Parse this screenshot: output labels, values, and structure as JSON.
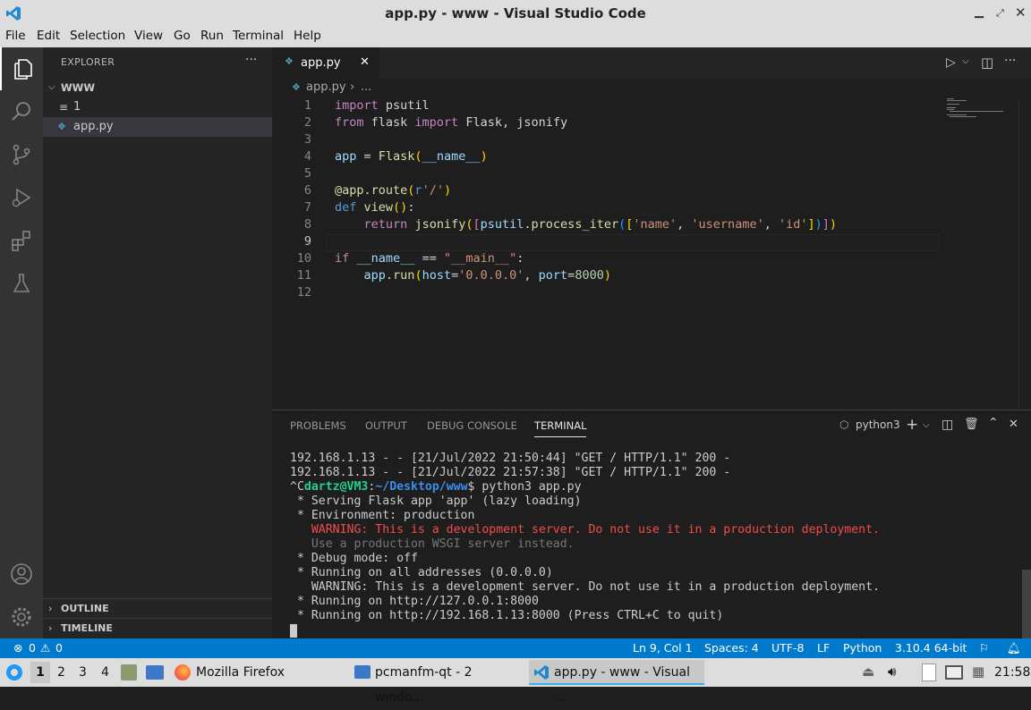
{
  "window": {
    "title": "app.py - www - Visual Studio Code"
  },
  "menu": [
    "File",
    "Edit",
    "Selection",
    "View",
    "Go",
    "Run",
    "Terminal",
    "Help"
  ],
  "sidebar": {
    "title": "EXPLORER",
    "more": "···",
    "folder": "WWW",
    "items": [
      {
        "label": "1"
      },
      {
        "label": "app.py"
      }
    ],
    "sections": [
      "OUTLINE",
      "TIMELINE"
    ]
  },
  "tab": {
    "label": "app.py"
  },
  "breadcrumb": {
    "file": "app.py",
    "sep": "›",
    "more": "..."
  },
  "editor": {
    "line_numbers": [
      "1",
      "2",
      "3",
      "4",
      "5",
      "6",
      "7",
      "8",
      "9",
      "10",
      "11",
      "12"
    ],
    "current_line": 9
  },
  "panel": {
    "tabs": [
      "PROBLEMS",
      "OUTPUT",
      "DEBUG CONSOLE",
      "TERMINAL"
    ],
    "active_tab": "TERMINAL",
    "terminal_name": "python3",
    "lines": [
      "192.168.1.13 - - [21/Jul/2022 21:50:44] \"GET / HTTP/1.1\" 200 -",
      "192.168.1.13 - - [21/Jul/2022 21:57:38] \"GET / HTTP/1.1\" 200 -",
      "",
      " * Serving Flask app 'app' (lazy loading)",
      " * Environment: production",
      "   WARNING: This is a development server. Do not use it in a production deployment.",
      "   Use a production WSGI server instead.",
      " * Debug mode: off",
      " * Running on all addresses (0.0.0.0)",
      "   WARNING: This is a development server. Do not use it in a production deployment.",
      " * Running on http://127.0.0.1:8000",
      " * Running on http://192.168.1.13:8000 (Press CTRL+C to quit)"
    ],
    "prompt": {
      "ctrl": "^C",
      "user": "dartz@VM3",
      "colon": ":",
      "path": "~/Desktop/www",
      "cmd": "$ python3 app.py"
    }
  },
  "status": {
    "errors": "0",
    "warnings": "0",
    "position": "Ln 9, Col 1",
    "spaces": "Spaces: 4",
    "encoding": "UTF-8",
    "eol": "LF",
    "language": "Python",
    "interpreter": "3.10.4 64-bit"
  },
  "taskbar": {
    "workspaces": [
      "1",
      "2",
      "3",
      "4"
    ],
    "windows": [
      "Mozilla Firefox",
      "pcmanfm-qt - 2 windo...",
      "app.py - www - Visual ..."
    ],
    "clock": "21:58"
  },
  "colors": {
    "accent": "#007acc",
    "warning_text": "#f14c4c",
    "prompt_user": "#23d18b",
    "prompt_path": "#3b8eea"
  }
}
